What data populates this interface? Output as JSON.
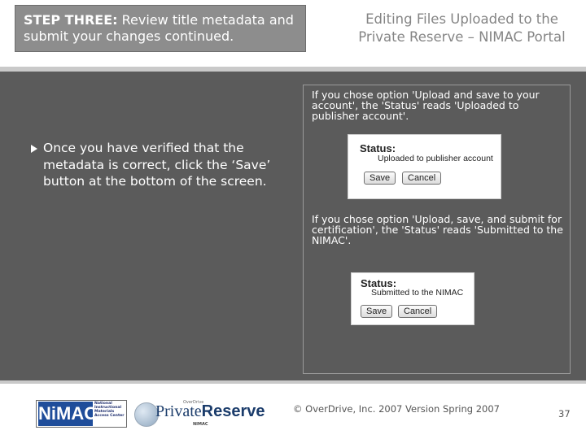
{
  "header": {
    "step_prefix": "STEP THREE:",
    "step_text": "Review title metadata and submit your changes continued.",
    "title_line1": "Editing Files Uploaded to the",
    "title_line2": "Private Reserve – NIMAC Portal"
  },
  "main": {
    "bullet": "Once you have verified that the metadata is correct, click the ‘Save’ button at the bottom of the screen."
  },
  "panel": {
    "note1": "If you chose option 'Upload and save to your account', the 'Status' reads 'Uploaded to publisher account'.",
    "example1": {
      "status_label": "Status:",
      "status_value": "Uploaded to publisher account",
      "save_label": "Save",
      "cancel_label": "Cancel"
    },
    "note2": "If you chose option 'Upload, save, and submit for certification', the 'Status' reads 'Submitted to the NIMAC'.",
    "example2": {
      "status_label": "Status:",
      "status_value": "Submitted to the NIMAC",
      "save_label": "Save",
      "cancel_label": "Cancel"
    }
  },
  "footer": {
    "nimac_logo_text": "NiMAC",
    "nimac_logo_subtext": "National Instructional Materials Access Center",
    "pr_logo_tag": "OverDrive",
    "pr_logo_text_a": "Private",
    "pr_logo_text_b": "Reserve",
    "pr_logo_sub": "NIMAC",
    "copyright": "© OverDrive, Inc. 2007   Version Spring 2007",
    "page_number": "37"
  },
  "colors": {
    "background": "#5b5b5b",
    "step_box": "#8d8d8d",
    "title_text": "#858585",
    "nimac_blue": "#1f4d9a"
  }
}
